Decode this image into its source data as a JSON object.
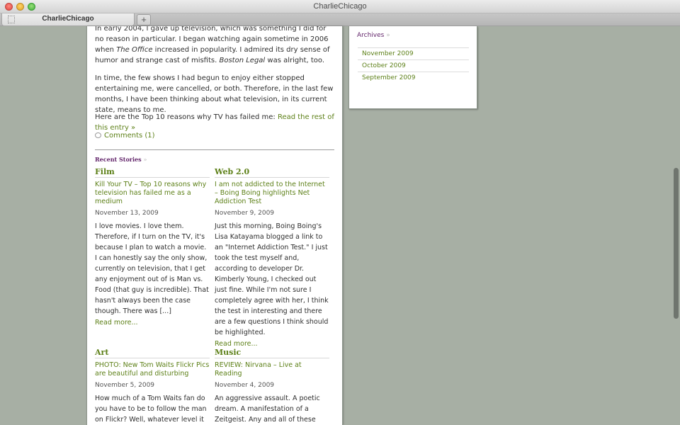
{
  "window": {
    "title": "CharlieChicago"
  },
  "tabs": [
    {
      "label": "CharlieChicago"
    }
  ],
  "new_tab": "+",
  "article": {
    "para1_a": "In early 2004, I gave up television, which was something I did for no reason in particular. I began watching again sometime in 2006 when ",
    "para1_office": "The Office",
    "para1_b": " increased in popularity. I admired its dry sense of humor and strange cast of misfits. ",
    "para1_boston": "Boston Legal",
    "para1_c": " was alright, too.",
    "para2": "In time, the few shows I had begun to enjoy either stopped entertaining me, were cancelled, or both. Therefore, in the last few months, I have been thinking about what television, in its current state, means to me.",
    "para3_text": "Here are the Top 10 reasons why TV has failed me: ",
    "read_rest": "Read the rest of this entry »",
    "comments": "Comments (1)"
  },
  "recent": {
    "title": "Recent Stories",
    "arrow": "»",
    "stories": [
      {
        "category": "Film",
        "headline": "Kill Your TV – Top 10 reasons why television has failed me as a medium",
        "date": "November 13, 2009",
        "excerpt": "I love movies. I love them. Therefore, if I turn on the TV, it's because I plan to watch a movie. I can honestly say the only show, currently on television, that I get any enjoyment out of is Man vs. Food (that guy is incredible). That hasn't always been the case though. There was [...]",
        "read_more": "Read more..."
      },
      {
        "category": "Web 2.0",
        "headline": "I am not addicted to the Internet – Boing Boing highlights Net Addiction Test",
        "date": "November 9, 2009",
        "excerpt": "Just this morning, Boing Boing's Lisa Katayama blogged a link to an \"Internet Addiction Test.\" I just took the test myself and, according to developer Dr. Kimberly Young, I checked out just fine. While I'm not sure I completely agree with her, I think the test in interesting and there are a few questions I think should be highlighted.",
        "read_more": "Read more..."
      },
      {
        "category": "Art",
        "headline": "PHOTO: New Tom Waits Flickr Pics are beautiful and disturbing",
        "date": "November 5, 2009",
        "excerpt": "How much of a Tom Waits fan do you have to be to follow the man on Flickr? Well, whatever level it is, that's",
        "read_more": ""
      },
      {
        "category": "Music",
        "headline": "REVIEW: Nirvana – Live at Reading",
        "date": "November 4, 2009",
        "excerpt": "An aggressive assault. A poetic dream. A manifestation of a Zeitgeist. Any and all of these could define Nirvana's headlining performance at the final",
        "read_more": ""
      }
    ]
  },
  "sidebar": {
    "archives_title": "Archives",
    "arrow": "»",
    "archives": [
      "November 2009",
      "October 2009",
      "September 2009"
    ]
  }
}
